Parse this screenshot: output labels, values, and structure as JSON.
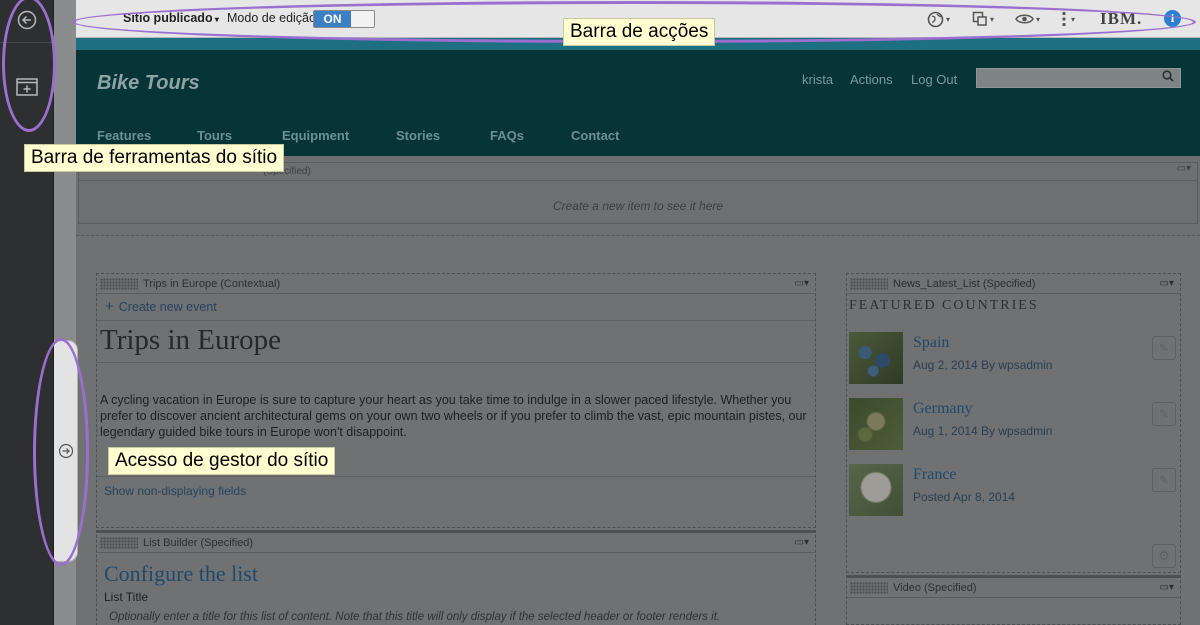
{
  "action_bar": {
    "site_selector": "Sítio publicado",
    "edit_mode_label": "Modo de edição",
    "toggle_state": "ON",
    "brand": "IBM.",
    "info": "i"
  },
  "site": {
    "brand": "Bike Tours",
    "user": "krista",
    "actions": "Actions",
    "logout": "Log Out",
    "nav": [
      "Features",
      "Tours",
      "Equipment",
      "Stories",
      "FAQs",
      "Contact"
    ]
  },
  "strip": {
    "header": "(Specified)",
    "empty_text": "Create a new item to see it here"
  },
  "trips": {
    "header": "Trips in Europe (Contextual)",
    "create_label": "Create new event",
    "title": "Trips in Europe",
    "body": "A cycling vacation in Europe is sure to capture your heart as you take time to indulge in a slower paced lifestyle. Whether you prefer to discover ancient architectural gems on your own two wheels or if you prefer to climb the vast, epic mountain pistes, our legendary guided bike tours in Europe won't disappoint.",
    "show_fields": "Show non-displaying fields"
  },
  "list_builder": {
    "header": "List Builder (Specified)",
    "title": "Configure the list",
    "subtitle": "List Title",
    "note": "Optionally enter a title for this list of content. Note that this title will only display if the selected header or footer renders it."
  },
  "news": {
    "header": "News_Latest_List (Specified)",
    "section_title": "FEATURED COUNTRIES",
    "items": [
      {
        "title": "Spain",
        "meta": "Aug 2, 2014 By wpsadmin"
      },
      {
        "title": "Germany",
        "meta": "Aug 1, 2014 By wpsadmin"
      },
      {
        "title": "France",
        "meta": "Posted Apr 8, 2014"
      }
    ]
  },
  "video": {
    "header": "Video (Specified)"
  },
  "callouts": {
    "action_bar": "Barra de acções",
    "site_toolbar": "Barra de ferramentas do sítio",
    "manager": "Acesso de gestor do sítio"
  }
}
